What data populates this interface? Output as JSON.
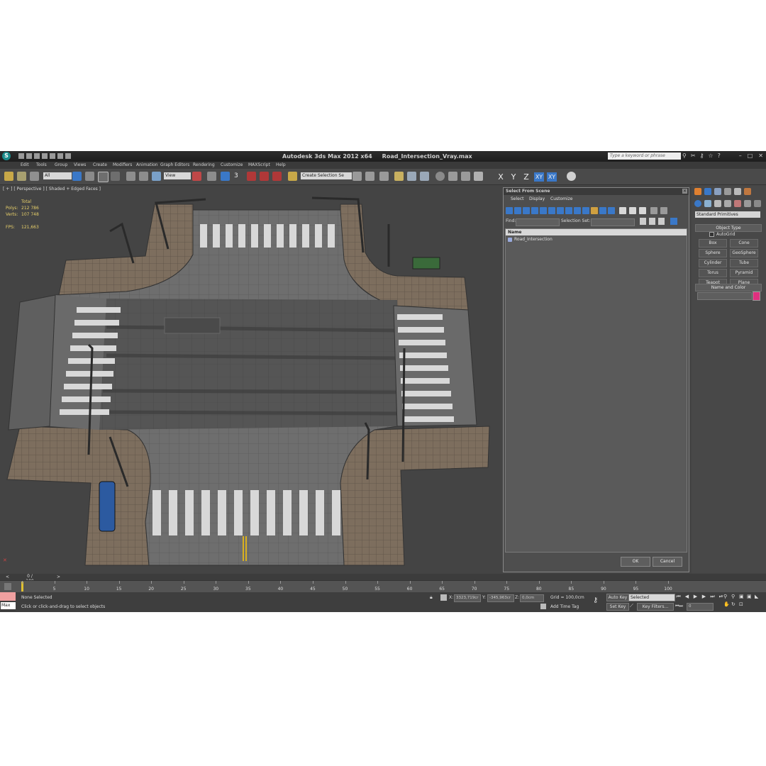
{
  "title": {
    "app": "Autodesk 3ds Max  2012 x64",
    "file": "Road_Intersection_Vray.max",
    "search_placeholder": "Type a keyword or phrase"
  },
  "menu": [
    "Edit",
    "Tools",
    "Group",
    "Views",
    "Create",
    "Modifiers",
    "Animation",
    "Graph Editors",
    "Rendering",
    "Customize",
    "MAXScript",
    "Help"
  ],
  "toolbar": {
    "filter_value": "All",
    "reference_coord": "View",
    "selection_set": "Create Selection Se",
    "snap_value": "3",
    "axes": [
      "X",
      "Y",
      "Z",
      "XY",
      "XY"
    ]
  },
  "viewport": {
    "label": "[ + ] [ Perspective ] [ Shaded + Edged Faces ]",
    "stats": {
      "total_label": "Total",
      "polys_label": "Polys:",
      "polys_value": "212 786",
      "verts_label": "Verts:",
      "verts_value": "107 748",
      "fps_label": "FPS:",
      "fps_value": "121,663"
    }
  },
  "dialog": {
    "title": "Select From Scene",
    "menu": [
      "Select",
      "Display",
      "Customize"
    ],
    "find_label": "Find:",
    "selection_set_label": "Selection Set:",
    "column_name": "Name",
    "items": [
      "Road_Intersection"
    ],
    "ok_label": "OK",
    "cancel_label": "Cancel"
  },
  "command_panel": {
    "category": "Standard Primitives",
    "object_type_label": "Object Type",
    "autogrid_label": "AutoGrid",
    "objects": [
      "Box",
      "Cone",
      "Sphere",
      "GeoSphere",
      "Cylinder",
      "Tube",
      "Torus",
      "Pyramid",
      "Teapot",
      "Plane"
    ],
    "name_color_label": "Name and Color",
    "swatch_color": "#e0307f"
  },
  "timeline": {
    "slider_label": "0 / 100",
    "ticks": [
      "0",
      "5",
      "10",
      "15",
      "20",
      "25",
      "30",
      "35",
      "40",
      "45",
      "50",
      "55",
      "60",
      "65",
      "70",
      "75",
      "80",
      "85",
      "90",
      "95",
      "100"
    ]
  },
  "status": {
    "maxscript_label": "Max",
    "selection": "None Selected",
    "prompt": "Click or click-and-drag to select objects",
    "x_label": "X:",
    "x_value": "3323,719cr",
    "y_label": "Y:",
    "y_value": "-345,963cr",
    "z_label": "Z:",
    "z_value": "0,0cm",
    "grid": "Grid = 100,0cm",
    "add_time_tag": "Add Time Tag",
    "auto_key": "Auto Key",
    "set_key": "Set Key",
    "key_mode": "Selected",
    "key_filters": "Key Filters...",
    "frame": "0"
  }
}
